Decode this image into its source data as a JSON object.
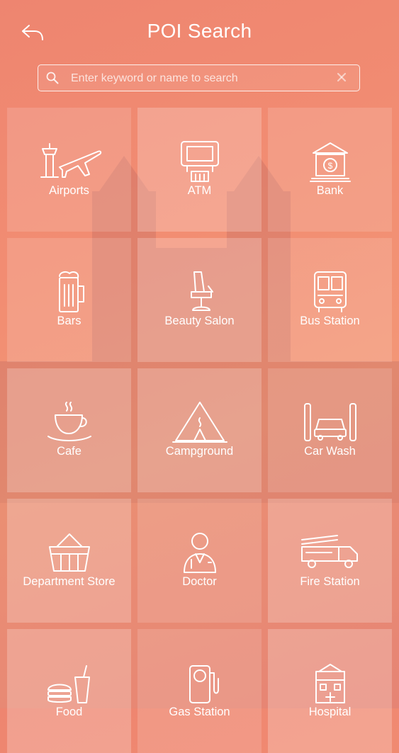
{
  "header": {
    "title": "POI Search",
    "back_icon": "back-arrow-icon"
  },
  "search": {
    "placeholder": "Enter keyword or name to search",
    "value": "",
    "search_icon": "search-icon",
    "clear_icon": "close-icon"
  },
  "categories": [
    {
      "label": "Airports",
      "icon": "airport-icon"
    },
    {
      "label": "ATM",
      "icon": "atm-icon"
    },
    {
      "label": "Bank",
      "icon": "bank-icon"
    },
    {
      "label": "Bars",
      "icon": "beer-mug-icon"
    },
    {
      "label": "Beauty Salon",
      "icon": "salon-chair-icon"
    },
    {
      "label": "Bus Station",
      "icon": "bus-icon"
    },
    {
      "label": "Cafe",
      "icon": "coffee-cup-icon"
    },
    {
      "label": "Campground",
      "icon": "tent-icon"
    },
    {
      "label": "Car Wash",
      "icon": "car-wash-icon"
    },
    {
      "label": "Department Store",
      "icon": "basket-icon"
    },
    {
      "label": "Doctor",
      "icon": "doctor-icon"
    },
    {
      "label": "Fire Station",
      "icon": "fire-truck-icon"
    },
    {
      "label": "Food",
      "icon": "burger-drink-icon"
    },
    {
      "label": "Gas Station",
      "icon": "gas-pump-icon"
    },
    {
      "label": "Hospital",
      "icon": "hospital-icon"
    }
  ],
  "colors": {
    "background_top": "#ee8570",
    "background_bottom": "#f39676",
    "foreground": "#ffffff"
  }
}
